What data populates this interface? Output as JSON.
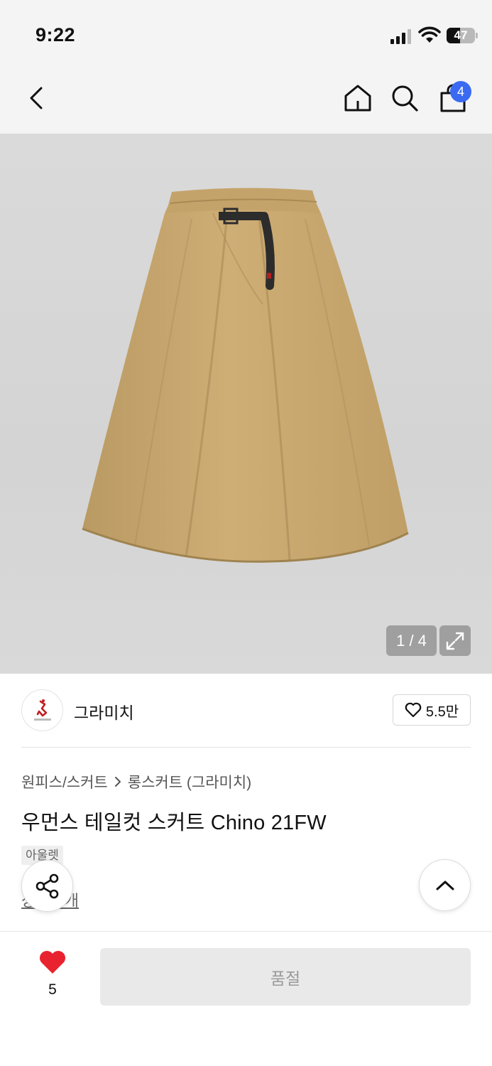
{
  "status_bar": {
    "time": "9:22",
    "battery": "47",
    "battery_level_percent": 47
  },
  "nav": {
    "cart_count": "4",
    "icons": [
      "back-chevron-icon",
      "home-icon",
      "search-icon",
      "shopping-bag-icon"
    ]
  },
  "gallery": {
    "pager": "1 / 4",
    "current": 1,
    "total": 4
  },
  "brand": {
    "name": "그라미치",
    "likes": "5.5만"
  },
  "product": {
    "breadcrumb_category": "원피스/스커트",
    "breadcrumb_sub": "롱스커트 (그라미치)",
    "title": "우먼스 테일컷 스커트 Chino 21FW",
    "tag": "아울렛",
    "link_text": "상품소개"
  },
  "bottom_bar": {
    "wish_count": "5",
    "soldout_label": "품절"
  },
  "colors": {
    "accent_blue": "#3b6af2",
    "heart_red": "#e8232f",
    "skirt_khaki": "#c8a76f",
    "disabled_button": "#e9e9e9"
  }
}
